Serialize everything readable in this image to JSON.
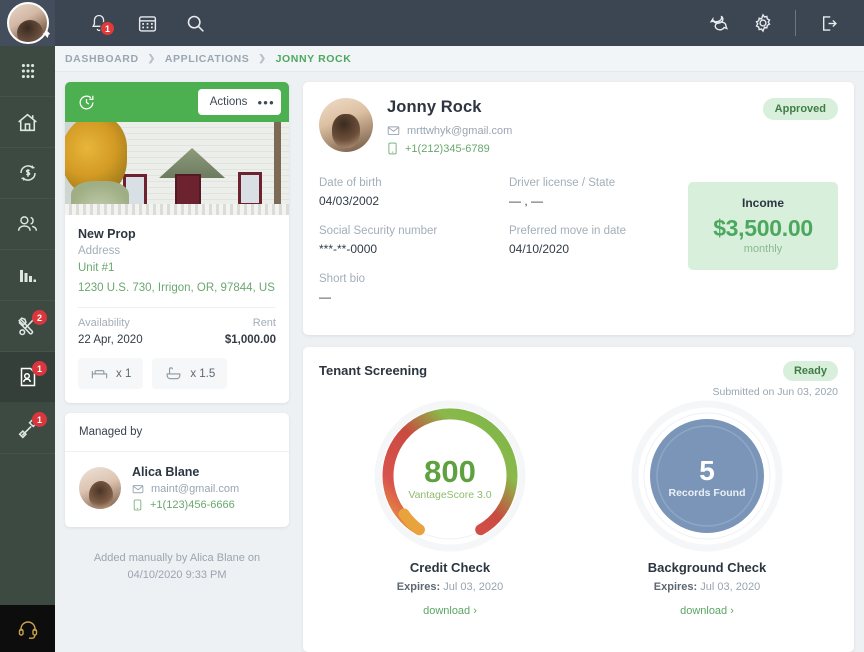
{
  "topbar": {
    "notifications_count": "1",
    "icons": [
      "bell-icon",
      "calendar-icon",
      "search-icon",
      "chat-icon",
      "gear-icon",
      "logout-icon"
    ]
  },
  "sidebar": {
    "items": [
      {
        "name": "apps-grid-icon",
        "badge": ""
      },
      {
        "name": "home-icon",
        "badge": ""
      },
      {
        "name": "payments-refresh-icon",
        "badge": ""
      },
      {
        "name": "people-icon",
        "badge": ""
      },
      {
        "name": "reports-chart-icon",
        "badge": ""
      },
      {
        "name": "maintenance-tools-icon",
        "badge": "2"
      },
      {
        "name": "applications-id-icon",
        "badge": "1"
      },
      {
        "name": "leases-link-icon",
        "badge": "1"
      }
    ],
    "support_icon": "headset-icon"
  },
  "breadcrumb": {
    "dashboard": "DASHBOARD",
    "applications": "APPLICATIONS",
    "current": "JONNY ROCK",
    "separator": "❯"
  },
  "property": {
    "header_icon": "history-clock-icon",
    "actions_label": "Actions",
    "kebab": "•••",
    "name": "New Prop",
    "address_label": "Address",
    "unit": "Unit #1",
    "address": "1230 U.S. 730, Irrigon, OR, 97844, US",
    "availability_label": "Availability",
    "availability_value": "22 Apr, 2020",
    "rent_label": "Rent",
    "rent_value": "$1,000.00",
    "beds": "x 1",
    "baths": "x 1.5"
  },
  "managed_by": {
    "title": "Managed by",
    "name": "Alica Blane",
    "email": "maint@gmail.com",
    "phone": "+1(123)456-6666",
    "added_line1": "Added manually by Alica Blane on",
    "added_line2": "04/10/2020 9:33 PM"
  },
  "applicant": {
    "name": "Jonny Rock",
    "email": "mrttwhyk@gmail.com",
    "phone": "+1(212)345-6789",
    "status": "Approved",
    "fields": [
      {
        "label": "Date of birth",
        "value": "04/03/2002"
      },
      {
        "label": "Driver license / State",
        "value": "— , —"
      },
      {
        "label": "Social Security number",
        "value": "***-**-0000"
      },
      {
        "label": "Preferred move in date",
        "value": "04/10/2020"
      }
    ],
    "short_bio_label": "Short bio",
    "short_bio_value": "—",
    "income_label": "Income",
    "income_amount": "$3,500.00",
    "income_period": "monthly"
  },
  "screening": {
    "title": "Tenant Screening",
    "status": "Ready",
    "submitted": "Submitted on Jun 03, 2020",
    "credit": {
      "score": "800",
      "score_label": "VantageScore 3.0",
      "title": "Credit Check",
      "expires_label": "Expires:",
      "expires_value": "Jul 03, 2020",
      "download": "download ›"
    },
    "background": {
      "count": "5",
      "count_label": "Records Found",
      "title": "Background Check",
      "expires_label": "Expires:",
      "expires_value": "Jul 03, 2020",
      "download": "download ›"
    }
  },
  "colors": {
    "accent_green": "#4cb050",
    "header_dark": "#3c4552",
    "rail_dark": "#3c4a42",
    "badge_red": "#d9363e",
    "pill_green_bg": "#d8efdb",
    "blue_circle": "#7a95b8"
  }
}
